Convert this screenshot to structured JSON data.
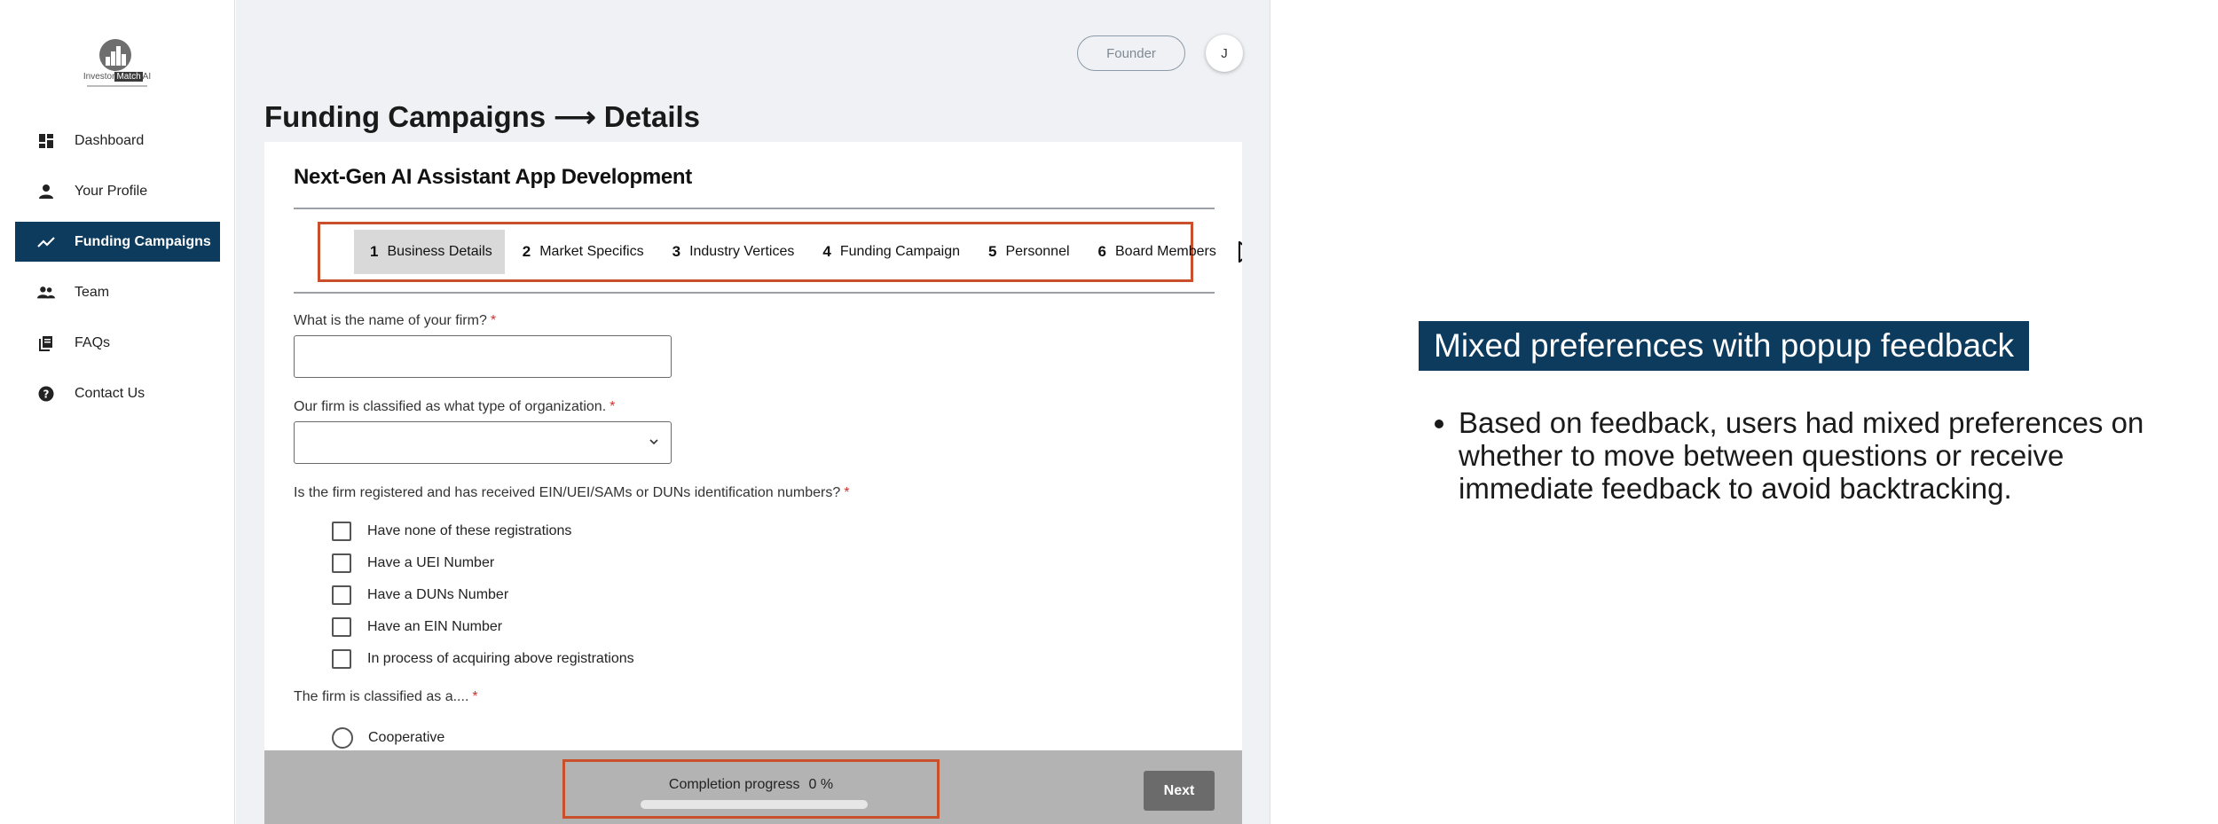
{
  "logo": {
    "text_prefix": "Investor",
    "text_highlight": "Match",
    "text_suffix": "AI"
  },
  "sidebar": {
    "items": [
      {
        "label": "Dashboard",
        "icon": "grid-icon",
        "active": false
      },
      {
        "label": "Your Profile",
        "icon": "person-icon",
        "active": false
      },
      {
        "label": "Funding Campaigns",
        "icon": "trending-icon",
        "active": true
      },
      {
        "label": "Team",
        "icon": "people-icon",
        "active": false
      },
      {
        "label": "FAQs",
        "icon": "book-icon",
        "active": false
      },
      {
        "label": "Contact Us",
        "icon": "help-icon",
        "active": false
      }
    ]
  },
  "header": {
    "role_button": "Founder",
    "avatar_initial": "J"
  },
  "page": {
    "title": "Funding Campaigns ⟶ Details"
  },
  "card": {
    "title": "Next-Gen AI Assistant App Development",
    "steps": [
      {
        "num": "1",
        "label": "Business Details",
        "active": true
      },
      {
        "num": "2",
        "label": "Market Specifics",
        "active": false
      },
      {
        "num": "3",
        "label": "Industry Vertices",
        "active": false
      },
      {
        "num": "4",
        "label": "Funding Campaign",
        "active": false
      },
      {
        "num": "5",
        "label": "Personnel",
        "active": false
      },
      {
        "num": "6",
        "label": "Board Members",
        "active": false
      }
    ]
  },
  "form": {
    "q1": {
      "label": "What is the name of your firm?",
      "required": "*",
      "value": ""
    },
    "q2": {
      "label": "Our firm is classified as what type of organization.",
      "required": "*",
      "value": ""
    },
    "q3": {
      "label": "Is the firm registered and has received EIN/UEI/SAMs or DUNs identification numbers?",
      "required": "*",
      "options": [
        "Have none of these registrations",
        "Have a UEI Number",
        "Have a DUNs Number",
        "Have an EIN Number",
        "In process of acquiring above registrations"
      ]
    },
    "q4": {
      "label": "The firm is classified as a....",
      "required": "*",
      "options": [
        "Cooperative"
      ]
    }
  },
  "footer": {
    "progress_label": "Completion progress",
    "progress_value": "0 %",
    "progress_fraction": 0,
    "next_label": "Next"
  },
  "slide": {
    "title": "Mixed preferences with popup feedback",
    "bullets": [
      "Based on feedback, users had mixed preferences on whether to move between questions or receive immediate feedback to avoid backtracking."
    ]
  },
  "colors": {
    "accent": "#0d3b5e",
    "highlight_border": "#c9502a",
    "required": "#d0312d",
    "footer": "#b3b3b3"
  }
}
